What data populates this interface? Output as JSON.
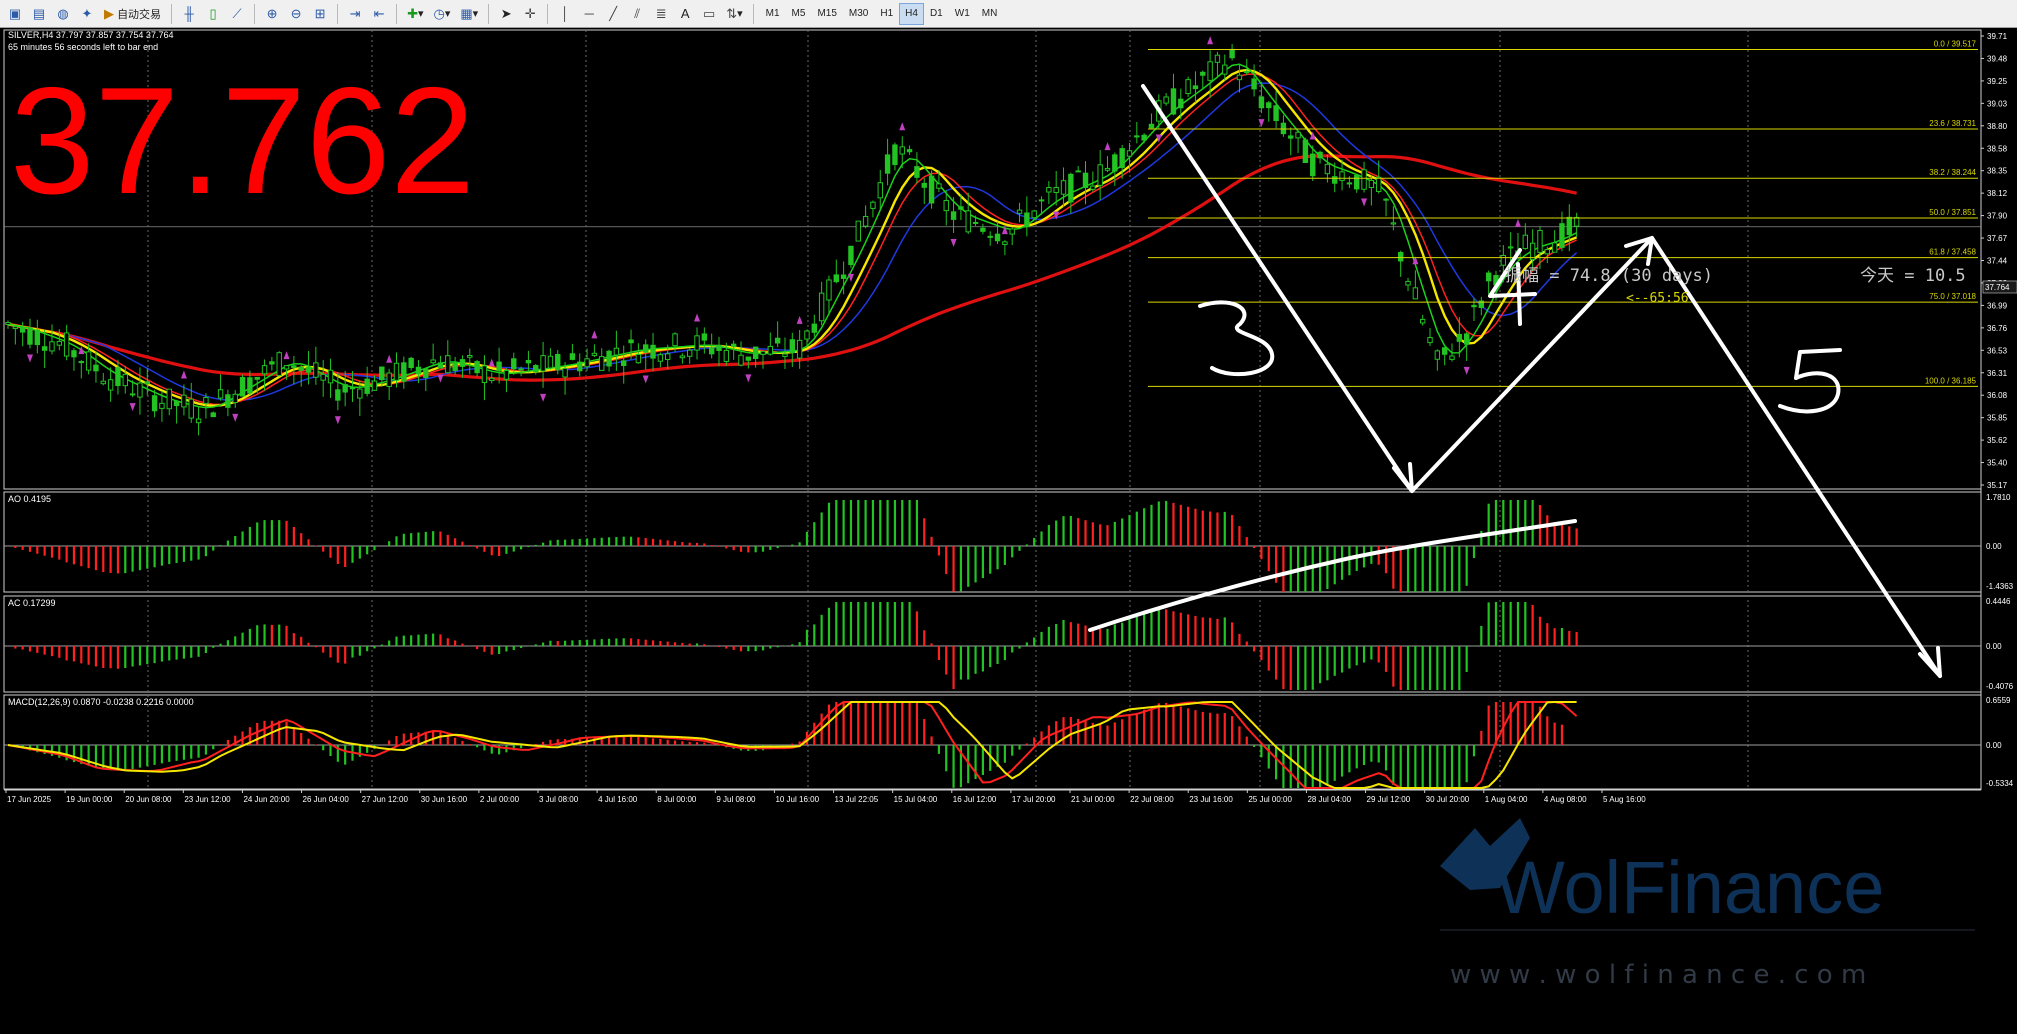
{
  "toolbar": {
    "autotrade_label": "自动交易",
    "timeframes": [
      "M1",
      "M5",
      "M15",
      "M30",
      "H1",
      "H4",
      "D1",
      "W1",
      "MN"
    ],
    "active_timeframe": "H4"
  },
  "chart": {
    "symbol_line": "SILVER,H4  37.797 37.857 37.754 37.764",
    "countdown": "65 minutes 56 seconds left to bar end",
    "big_price": "37.762",
    "current_price_label": "37.764",
    "annotation_amplitude": "振幅 = 74.8  (30 days)",
    "annotation_today": "今天 = 10.5",
    "annotation_time": "<--65:56",
    "wave_labels": [
      "3",
      "4",
      "5"
    ],
    "watermark_brand": "WolFinance",
    "watermark_url": "w w w . w o l f i n a n c e . c o m"
  },
  "price_axis_ticks": [
    "39.71",
    "39.48",
    "39.25",
    "39.03",
    "38.80",
    "38.58",
    "38.35",
    "38.12",
    "37.90",
    "37.67",
    "37.44",
    "37.22",
    "36.99",
    "36.76",
    "36.53",
    "36.31",
    "36.08",
    "35.85",
    "35.62",
    "35.40",
    "35.17"
  ],
  "fib_levels": [
    {
      "label": "0.0  /  39.517",
      "value": 39.517
    },
    {
      "label": "23.6  /  38.731",
      "value": 38.731
    },
    {
      "label": "38.2  /  38.244",
      "value": 38.244
    },
    {
      "label": "50.0  /  37.851",
      "value": 37.851
    },
    {
      "label": "61.8  /  37.458",
      "value": 37.458
    },
    {
      "label": "75.0  /  37.018",
      "value": 37.018
    },
    {
      "label": "100.0  /  36.185",
      "value": 36.185
    }
  ],
  "time_axis_labels": [
    "17 Jun 2025",
    "19 Jun 00:00",
    "20 Jun 08:00",
    "23 Jun 12:00",
    "24 Jun 20:00",
    "26 Jun 04:00",
    "27 Jun 12:00",
    "30 Jun 16:00",
    "2 Jul 00:00",
    "3 Jul 08:00",
    "4 Jul 16:00",
    "8 Jul 00:00",
    "9 Jul 08:00",
    "10 Jul 16:00",
    "13 Jul 22:05",
    "15 Jul 04:00",
    "16 Jul 12:00",
    "17 Jul 20:00",
    "21 Jul 00:00",
    "22 Jul 08:00",
    "23 Jul 16:00",
    "25 Jul 00:00",
    "28 Jul 04:00",
    "29 Jul 12:00",
    "30 Jul 20:00",
    "1 Aug 04:00",
    "4 Aug 08:00",
    "5 Aug 16:00"
  ],
  "subwindows": {
    "ao": {
      "label": "AO 0.4195",
      "top_tick": "1.7810",
      "zero_tick": "0.00",
      "bottom_tick": "-1.4363"
    },
    "ac": {
      "label": "AC 0.17299",
      "top_tick": "0.4446",
      "zero_tick": "0.00",
      "bottom_tick": "-0.4076"
    },
    "macd": {
      "label": "MACD(12,26,9) 0.0870 -0.0238 0.2216 0.0000",
      "top_tick": "0.6559",
      "zero_tick": "0.00",
      "bottom_tick": "-0.5334"
    }
  },
  "colors": {
    "bull": "#22c322",
    "bear": "#ff2020",
    "ma_slow": "#e01010",
    "ma_blue": "#1f38e0",
    "ma_yellow": "#f5e600",
    "ma_green": "#1ad21a",
    "fib": "#d8d800",
    "fractal": "#c040c0",
    "drawing": "#ffffff",
    "big_price": "#ff0000"
  }
}
